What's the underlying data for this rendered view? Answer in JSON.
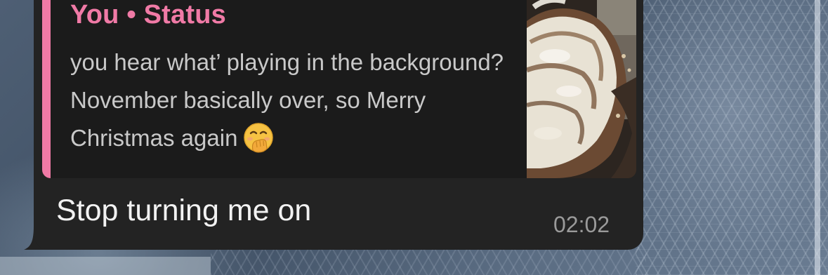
{
  "message": {
    "reply_quote": {
      "sender": "You",
      "separator": "•",
      "context": "Status",
      "text": "you hear what’ playing in the background? November basically over, so Merry Christmas again",
      "emoji": "face-with-hand-over-mouth-emoji",
      "thumbnail": "cinnamon-roll-photo"
    },
    "body": "Stop turning me on",
    "time": "02:02"
  },
  "colors": {
    "bubble": "#232323",
    "quote_background": "#1b1b1b",
    "quote_accent": "#f07aa6",
    "quote_text": "#c9c9c9",
    "message_text": "#f2f2f2",
    "timestamp": "#9a9a9a"
  }
}
